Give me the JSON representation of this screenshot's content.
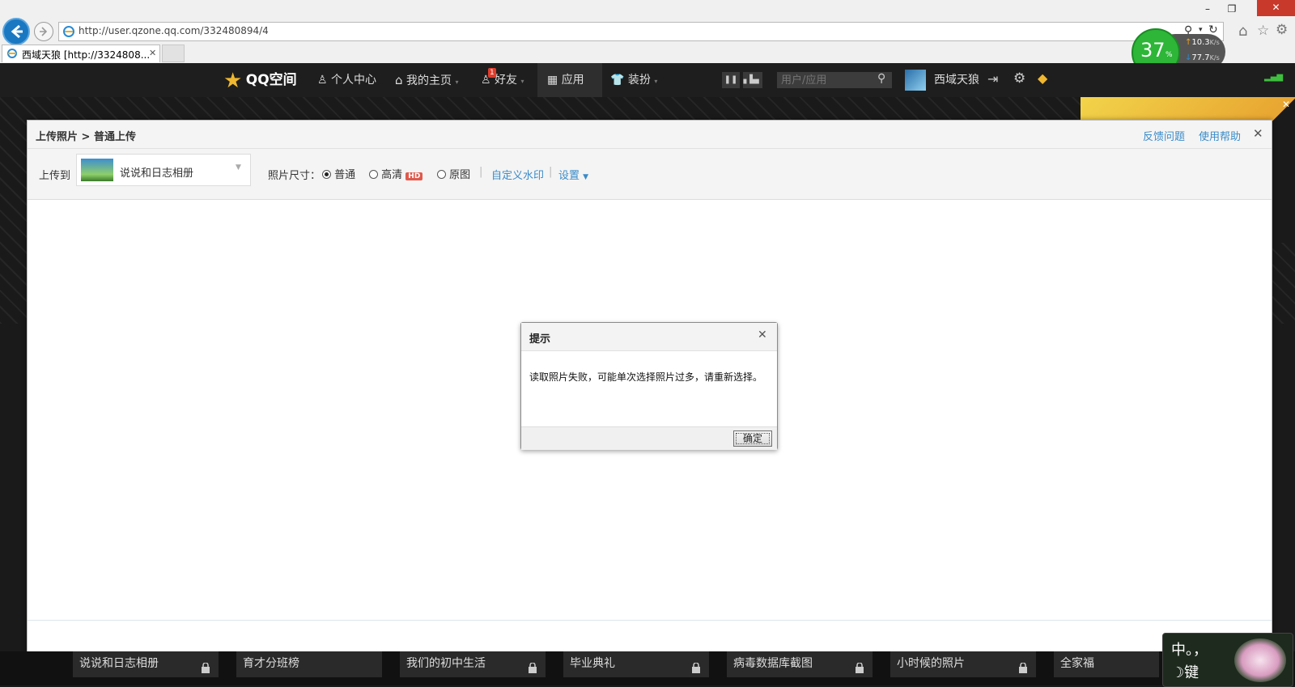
{
  "browser": {
    "url": "http://user.qzone.qq.com/332480894/4",
    "tab_title": "西域天狼 [http://3324808...",
    "tab_close": "✕",
    "perf": {
      "percent": "37",
      "percent_unit": "%",
      "upload": "10.3",
      "download": "77.7",
      "unit": "K/s"
    }
  },
  "nav": {
    "logo": "QQ空间",
    "personal_center": "个人中心",
    "my_home": "我的主页",
    "friends": "好友",
    "friends_badge": "1",
    "apps": "应用",
    "dress_up": "装扮",
    "search_placeholder": "用户/应用",
    "username": "西域天狼"
  },
  "upload": {
    "breadcrumb": "上传照片 > 普通上传",
    "feedback": "反馈问题",
    "help": "使用帮助",
    "upload_to_label": "上传到",
    "album_selected": "说说和日志相册",
    "size_label": "照片尺寸：",
    "size_options": [
      "普通",
      "高清",
      "原图"
    ],
    "size_selected": "普通",
    "hd_badge": "HD",
    "watermark": "自定义水印",
    "settings": "设置"
  },
  "alert": {
    "title": "提示",
    "message": "读取照片失败，可能单次选择照片过多，请重新选择。",
    "ok": "确定"
  },
  "albums": [
    {
      "name": "说说和日志相册"
    },
    {
      "name": "育才分班榜"
    },
    {
      "name": "我们的初中生活"
    },
    {
      "name": "毕业典礼"
    },
    {
      "name": "病毒数据库截图"
    },
    {
      "name": "小时候的照片"
    },
    {
      "name": "全家福"
    }
  ],
  "ime": {
    "line1": "中。，",
    "line2": "键"
  },
  "colors": {
    "accent": "#3a8bc8",
    "nav_bg": "#1e1e1e",
    "hd_badge": "#e05a4c",
    "perf_green": "#2db638"
  }
}
